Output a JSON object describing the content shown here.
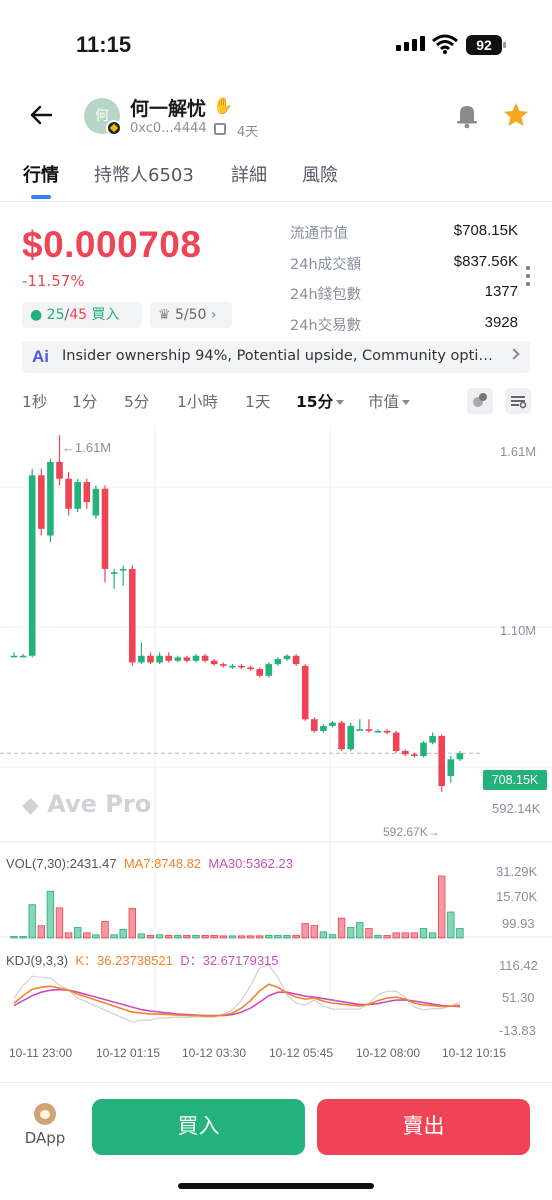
{
  "status_bar": {
    "time": "11:15",
    "battery": "92",
    "icons": [
      "signal-icon",
      "wifi-icon",
      "battery-icon"
    ]
  },
  "header": {
    "avatar_char": "何",
    "token_name": "何一解忧",
    "address": "0xc0...4444",
    "age": "4天",
    "icons": [
      "back-arrow-icon",
      "hand-emoji-icon",
      "copy-icon",
      "bell-icon",
      "star-icon"
    ],
    "colors": {
      "star": "#f5a623",
      "bell": "#888888"
    }
  },
  "tabs": [
    {
      "label": "行情",
      "active": true
    },
    {
      "label": "持幣人6503",
      "active": false
    },
    {
      "label": "詳細",
      "active": false
    },
    {
      "label": "風險",
      "active": false
    }
  ],
  "price": {
    "value": "$0.000708",
    "change": "-11.57%",
    "buy_ratio_green": "25",
    "buy_ratio_sep": "/",
    "buy_ratio_red": "45",
    "buy_label": "買入",
    "rank": "5/50",
    "colors": {
      "down": "#ee4455",
      "up": "#23b27a"
    }
  },
  "stats": [
    {
      "label": "流通市值",
      "value": "$708.15K"
    },
    {
      "label": "24h成交額",
      "value": "$837.56K"
    },
    {
      "label": "24h錢包數",
      "value": "1377"
    },
    {
      "label": "24h交易數",
      "value": "3928"
    }
  ],
  "ai_banner": {
    "logo": "Ai",
    "text": "Insider ownership 94%, Potential upside, Community optimi..."
  },
  "intervals": [
    {
      "label": "1秒",
      "active": false
    },
    {
      "label": "1分",
      "active": false
    },
    {
      "label": "5分",
      "active": false
    },
    {
      "label": "1小時",
      "active": false
    },
    {
      "label": "1天",
      "active": false
    },
    {
      "label": "15分",
      "active": true
    },
    {
      "label": "市值",
      "active": false
    }
  ],
  "chart": {
    "watermark": "Ave Pro",
    "high_marker": "←1.61M",
    "low_marker": "592.67K→",
    "axis_labels": [
      "1.61M",
      "1.10M",
      "592.14K"
    ],
    "current": "708.15K",
    "vol": {
      "label": "VOL(7,30):2431.47",
      "ma7": "MA7:8748.82",
      "ma30": "MA30:5362.23",
      "axis": [
        "31.29K",
        "15.70K",
        "99.93"
      ]
    },
    "kdj": {
      "label": "KDJ(9,3,3)",
      "k": "K：36.23738521",
      "d": "D：32.67179315",
      "axis": [
        "116.42",
        "51.30",
        "-13.83"
      ]
    },
    "time_labels": [
      "10-11 23:00",
      "10-12 01:15",
      "10-12 03:30",
      "10-12 05:45",
      "10-12 08:00",
      "10-12 10:15"
    ]
  },
  "chart_data": {
    "type": "candlestick",
    "unit": "market cap (USD)",
    "interval": "15分",
    "ylim": [
      592140,
      1610000
    ],
    "high": 1610000,
    "low": 592670,
    "last": 708150,
    "candles": [
      {
        "o": 1000000,
        "c": 1000000,
        "h": 1010000,
        "l": 995000
      },
      {
        "o": 1000000,
        "c": 1000000,
        "h": 1005000,
        "l": 995000
      },
      {
        "o": 1000000,
        "c": 1540000,
        "h": 1560000,
        "l": 995000
      },
      {
        "o": 1540000,
        "c": 1380000,
        "h": 1560000,
        "l": 1360000
      },
      {
        "o": 1360000,
        "c": 1580000,
        "h": 1590000,
        "l": 1340000
      },
      {
        "o": 1580000,
        "c": 1530000,
        "h": 1660000,
        "l": 1510000
      },
      {
        "o": 1530000,
        "c": 1440000,
        "h": 1550000,
        "l": 1420000
      },
      {
        "o": 1440000,
        "c": 1520000,
        "h": 1530000,
        "l": 1430000
      },
      {
        "o": 1520000,
        "c": 1460000,
        "h": 1530000,
        "l": 1440000
      },
      {
        "o": 1420000,
        "c": 1500000,
        "h": 1510000,
        "l": 1410000
      },
      {
        "o": 1500000,
        "c": 1260000,
        "h": 1510000,
        "l": 1220000
      },
      {
        "o": 1250000,
        "c": 1250000,
        "h": 1260000,
        "l": 1200000
      },
      {
        "o": 1260000,
        "c": 1260000,
        "h": 1270000,
        "l": 1210000
      },
      {
        "o": 1260000,
        "c": 980000,
        "h": 1270000,
        "l": 970000
      },
      {
        "o": 980000,
        "c": 1000000,
        "h": 1040000,
        "l": 975000
      },
      {
        "o": 1000000,
        "c": 980000,
        "h": 1010000,
        "l": 975000
      },
      {
        "o": 980000,
        "c": 1000000,
        "h": 1010000,
        "l": 975000
      },
      {
        "o": 1000000,
        "c": 985000,
        "h": 1010000,
        "l": 980000
      },
      {
        "o": 985000,
        "c": 995000,
        "h": 1000000,
        "l": 980000
      },
      {
        "o": 995000,
        "c": 985000,
        "h": 1000000,
        "l": 980000
      },
      {
        "o": 985000,
        "c": 1000000,
        "h": 1005000,
        "l": 980000
      },
      {
        "o": 1000000,
        "c": 985000,
        "h": 1005000,
        "l": 980000
      },
      {
        "o": 985000,
        "c": 975000,
        "h": 990000,
        "l": 970000
      },
      {
        "o": 975000,
        "c": 970000,
        "h": 980000,
        "l": 965000
      },
      {
        "o": 970000,
        "c": 970000,
        "h": 975000,
        "l": 960000
      },
      {
        "o": 970000,
        "c": 965000,
        "h": 975000,
        "l": 960000
      },
      {
        "o": 965000,
        "c": 960000,
        "h": 970000,
        "l": 955000
      },
      {
        "o": 960000,
        "c": 940000,
        "h": 965000,
        "l": 935000
      },
      {
        "o": 940000,
        "c": 975000,
        "h": 980000,
        "l": 935000
      },
      {
        "o": 975000,
        "c": 990000,
        "h": 995000,
        "l": 970000
      },
      {
        "o": 990000,
        "c": 1000000,
        "h": 1005000,
        "l": 985000
      },
      {
        "o": 1000000,
        "c": 975000,
        "h": 1005000,
        "l": 970000
      },
      {
        "o": 970000,
        "c": 810000,
        "h": 975000,
        "l": 805000
      },
      {
        "o": 810000,
        "c": 775000,
        "h": 815000,
        "l": 770000
      },
      {
        "o": 775000,
        "c": 790000,
        "h": 795000,
        "l": 770000
      },
      {
        "o": 790000,
        "c": 800000,
        "h": 805000,
        "l": 785000
      },
      {
        "o": 800000,
        "c": 720000,
        "h": 805000,
        "l": 715000
      },
      {
        "o": 720000,
        "c": 790000,
        "h": 800000,
        "l": 715000
      },
      {
        "o": 780000,
        "c": 780000,
        "h": 810000,
        "l": 775000
      },
      {
        "o": 780000,
        "c": 775000,
        "h": 810000,
        "l": 770000
      },
      {
        "o": 775000,
        "c": 775000,
        "h": 780000,
        "l": 770000
      },
      {
        "o": 775000,
        "c": 770000,
        "h": 780000,
        "l": 765000
      },
      {
        "o": 770000,
        "c": 715000,
        "h": 775000,
        "l": 710000
      },
      {
        "o": 715000,
        "c": 705000,
        "h": 720000,
        "l": 700000
      },
      {
        "o": 705000,
        "c": 700000,
        "h": 710000,
        "l": 695000
      },
      {
        "o": 700000,
        "c": 740000,
        "h": 745000,
        "l": 695000
      },
      {
        "o": 740000,
        "c": 760000,
        "h": 770000,
        "l": 735000
      },
      {
        "o": 760000,
        "c": 610000,
        "h": 765000,
        "l": 592670
      },
      {
        "o": 640000,
        "c": 690000,
        "h": 700000,
        "l": 620000
      },
      {
        "o": 690000,
        "c": 708150,
        "h": 715000,
        "l": 685000
      }
    ],
    "volume": [
      500,
      400,
      16800,
      6200,
      23600,
      15200,
      2600,
      5300,
      2600,
      1600,
      8400,
      1600,
      4400,
      14900,
      2100,
      1300,
      1600,
      1300,
      1300,
      1300,
      1300,
      1300,
      1300,
      1100,
      1100,
      1100,
      1100,
      1100,
      1300,
      1300,
      1300,
      1300,
      7300,
      6300,
      3100,
      1700,
      10000,
      5300,
      7800,
      4800,
      1300,
      1300,
      2600,
      2600,
      2600,
      4800,
      2600,
      31290,
      13100,
      4800
    ],
    "kdj_k": [
      40,
      55,
      68,
      72,
      74,
      70,
      66,
      58,
      52,
      46,
      40,
      34,
      28,
      22,
      20,
      18,
      18,
      17,
      16,
      15,
      15,
      14,
      14,
      16,
      20,
      30,
      45,
      65,
      78,
      72,
      60,
      52,
      48,
      50,
      44,
      40,
      38,
      36,
      34,
      38,
      45,
      50,
      52,
      48,
      40,
      36,
      35,
      33,
      34,
      36
    ],
    "kdj_d": [
      35,
      45,
      55,
      62,
      66,
      67,
      66,
      62,
      57,
      52,
      47,
      42,
      37,
      32,
      27,
      24,
      22,
      20,
      18,
      17,
      16,
      15,
      15,
      15,
      17,
      22,
      30,
      42,
      55,
      62,
      62,
      58,
      54,
      52,
      49,
      46,
      43,
      40,
      37,
      37,
      39,
      43,
      46,
      46,
      44,
      41,
      38,
      35,
      34,
      33
    ],
    "kdj_j": [
      50,
      75,
      94,
      92,
      90,
      76,
      66,
      50,
      42,
      34,
      26,
      18,
      10,
      2,
      6,
      6,
      10,
      11,
      12,
      11,
      13,
      12,
      12,
      18,
      26,
      46,
      75,
      111,
      116,
      92,
      56,
      40,
      36,
      46,
      34,
      28,
      28,
      28,
      28,
      40,
      57,
      64,
      64,
      52,
      32,
      26,
      29,
      29,
      34,
      42
    ]
  },
  "bottom": {
    "dapp_label": "DApp",
    "buy": "買入",
    "sell": "賣出",
    "colors": {
      "buy": "#23b27a",
      "sell": "#ee4455"
    }
  }
}
